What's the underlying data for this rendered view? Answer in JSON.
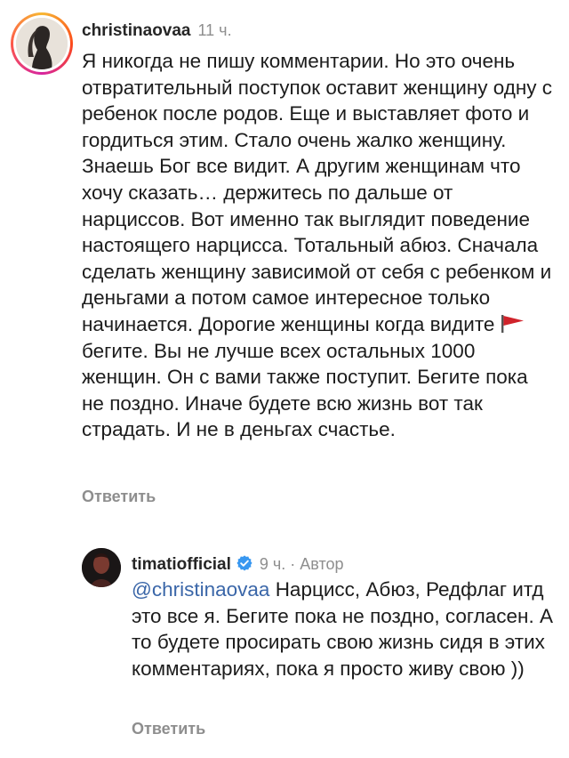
{
  "main_comment": {
    "username": "christinaovaa",
    "time": "11 ч.",
    "text_part1": "Я никогда не пишу комментарии. Но это очень отвратительный поступок оставит женщину одну с ребенок после родов. Еще и выставляет фото и гордиться этим. Стало очень жалко женщину. Знаешь Бог все видит. А другим женщинам что хочу сказать… держитесь по дальше от нарциссов. Вот именно так выглядит поведение настоящего нарцисса. Тотальный абюз. Сначала сделать женщину зависимой от себя с ребенком и деньгами а потом самое интересное только начинается. Дорогие женщины когда видите",
    "text_part2": "бегите. Вы не лучше всех остальных 1000 женщин. Он с вами также поступит. Бегите пока не поздно. Иначе будете всю жизнь вот так страдать. И не в деньгах счастье.",
    "inline_icon": "red-flag-icon",
    "reply_label": "Ответить"
  },
  "reply_comment": {
    "username": "timatiofficial",
    "verified_icon": "verified-badge-icon",
    "time": "9 ч.",
    "separator": "·",
    "author_label": "Автор",
    "mention": "@christinaovaa",
    "text": "Нарцисс, Абюз, Редфлаг итд это все я. Бегите пока не поздно, согласен. А то будете просирать свою жизнь сидя в этих комментариях, пока я просто живу свою ))",
    "reply_label": "Ответить"
  },
  "colors": {
    "text": "#1c1c1c",
    "muted": "#8e8e8e",
    "mention": "#3a66a8",
    "verified": "#3897f0",
    "flag": "#d0232b"
  }
}
